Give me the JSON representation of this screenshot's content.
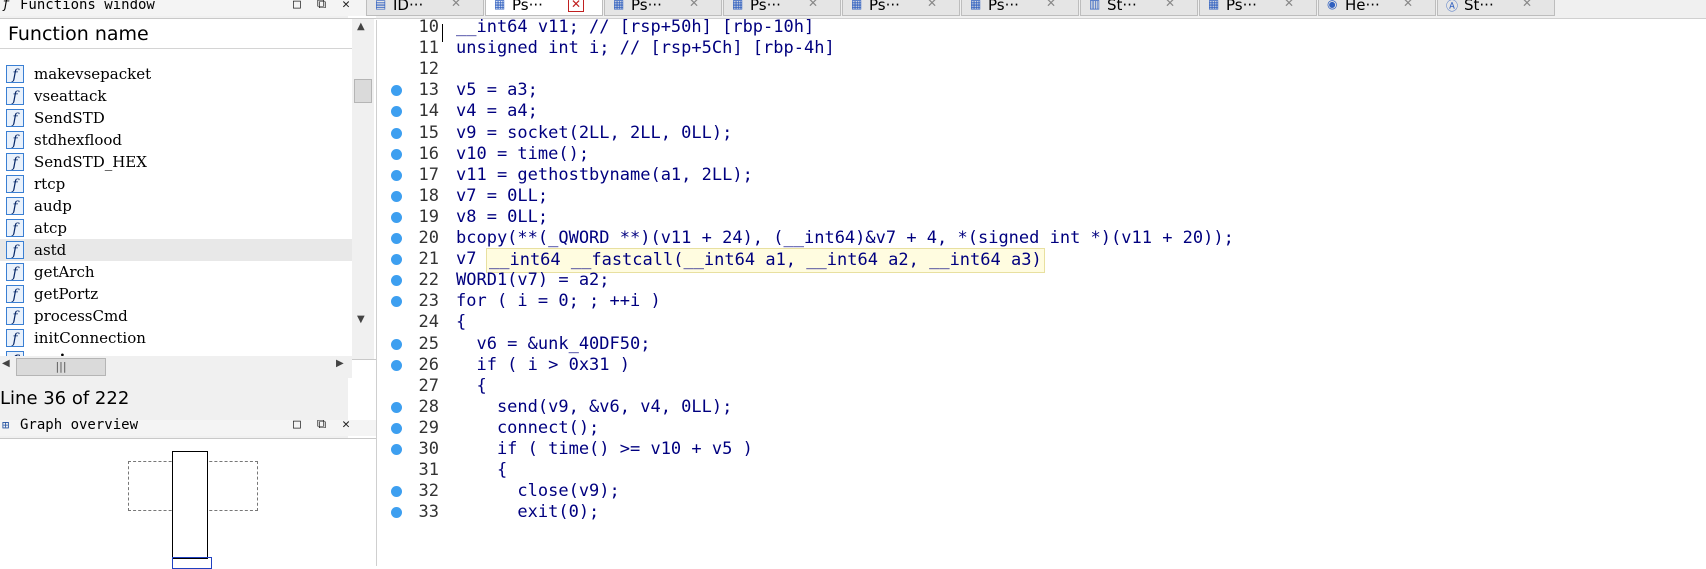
{
  "functions_window": {
    "title": "Functions window",
    "column_header": "Function name",
    "icon_glyph": "f",
    "items": [
      {
        "name": "makevsepacket"
      },
      {
        "name": "vseattack"
      },
      {
        "name": "SendSTD"
      },
      {
        "name": "stdhexflood"
      },
      {
        "name": "SendSTD_HEX"
      },
      {
        "name": "rtcp"
      },
      {
        "name": "audp"
      },
      {
        "name": "atcp"
      },
      {
        "name": "astd",
        "selected": true
      },
      {
        "name": "getArch"
      },
      {
        "name": "getPortz"
      },
      {
        "name": "processCmd"
      },
      {
        "name": "initConnection"
      },
      {
        "name": "main",
        "bold": true
      }
    ],
    "status": "Line 36 of 222",
    "window_buttons": [
      "□",
      "⧉",
      "✕"
    ]
  },
  "graph_overview": {
    "title": "Graph overview",
    "window_buttons": [
      "□",
      "⧉",
      "✕"
    ]
  },
  "tabs": [
    {
      "label": "ID···",
      "icon": "ida-view-icon",
      "close": "✕"
    },
    {
      "label": "Ps···",
      "icon": "pseudocode-icon",
      "close": "✕",
      "active": true
    },
    {
      "label": "Ps···",
      "icon": "pseudocode-icon",
      "close": "✕"
    },
    {
      "label": "Ps···",
      "icon": "pseudocode-icon",
      "close": "✕"
    },
    {
      "label": "Ps···",
      "icon": "pseudocode-icon",
      "close": "✕"
    },
    {
      "label": "Ps···",
      "icon": "pseudocode-icon",
      "close": "✕"
    },
    {
      "label": "St···",
      "icon": "structures-icon",
      "close": "✕"
    },
    {
      "label": "Ps···",
      "icon": "pseudocode-icon",
      "close": "✕"
    },
    {
      "label": "He···",
      "icon": "hex-view-icon",
      "close": "✕"
    },
    {
      "label": "St···",
      "icon": "strings-icon",
      "close": "✕"
    }
  ],
  "code": {
    "lines": [
      {
        "n": "10",
        "text": "__int64 v11; // [rsp+50h] [rbp-10h]",
        "bp": false
      },
      {
        "n": "11",
        "text": "unsigned int i; // [rsp+5Ch] [rbp-4h]",
        "bp": false
      },
      {
        "n": "12",
        "text": "",
        "bp": false
      },
      {
        "n": "13",
        "text": "v5 = a3;",
        "bp": true
      },
      {
        "n": "14",
        "text": "v4 = a4;",
        "bp": true
      },
      {
        "n": "15",
        "text": "v9 = socket(2LL, 2LL, 0LL);",
        "bp": true
      },
      {
        "n": "16",
        "text": "v10 = time();",
        "bp": true
      },
      {
        "n": "17",
        "text": "v11 = gethostbyname(a1, 2LL);",
        "bp": true
      },
      {
        "n": "18",
        "text": "v7 = 0LL;",
        "bp": true
      },
      {
        "n": "19",
        "text": "v8 = 0LL;",
        "bp": true
      },
      {
        "n": "20",
        "text": "bcopy(**(_QWORD **)(v11 + 24), (__int64)&v7 + 4, *(signed int *)(v11 + 20));",
        "bp": true
      },
      {
        "n": "21",
        "text": "v7",
        "bp": true
      },
      {
        "n": "22",
        "text": "WORD1(v7) = a2;",
        "bp": true
      },
      {
        "n": "23",
        "text": "for ( i = 0; ; ++i )",
        "bp": true
      },
      {
        "n": "24",
        "text": "{",
        "bp": false
      },
      {
        "n": "25",
        "text": "  v6 = &unk_40DF50;",
        "bp": true
      },
      {
        "n": "26",
        "text": "  if ( i > 0x31 )",
        "bp": true
      },
      {
        "n": "27",
        "text": "  {",
        "bp": false
      },
      {
        "n": "28",
        "text": "    send(v9, &v6, v4, 0LL);",
        "bp": true
      },
      {
        "n": "29",
        "text": "    connect();",
        "bp": true
      },
      {
        "n": "30",
        "text": "    if ( time() >= v10 + v5 )",
        "bp": true
      },
      {
        "n": "31",
        "text": "    {",
        "bp": false
      },
      {
        "n": "32",
        "text": "      close(v9);",
        "bp": true
      },
      {
        "n": "33",
        "text": "      exit(0);",
        "bp": true
      }
    ],
    "tooltip": "__int64 __fastcall(__int64 a1, __int64 a2, __int64 a3)"
  },
  "colors": {
    "code": "#00007f",
    "breakpoint": "#3d9ff0"
  }
}
